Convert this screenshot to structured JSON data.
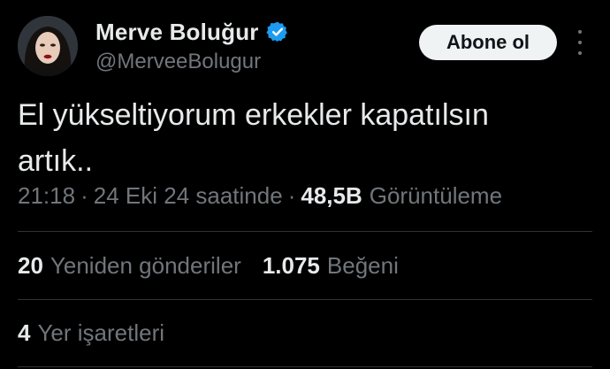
{
  "author": {
    "display_name": "Merve Boluğur",
    "handle": "@MerveeBolugur",
    "verified_icon": "verified-badge-icon"
  },
  "follow_button_label": "Abone ol",
  "more_icon": "more-options-icon",
  "tweet": {
    "text": "El yükseltiyorum erkekler kapatılsın\nartık.."
  },
  "meta": {
    "time": "21:18",
    "separator": "·",
    "date": "24 Eki 24 saatinde",
    "views_count": "48,5B",
    "views_label": "Görüntüleme"
  },
  "stats": {
    "reposts_count": "20",
    "reposts_label": "Yeniden gönderiler",
    "likes_count": "1.075",
    "likes_label": "Beğeni",
    "bookmarks_count": "4",
    "bookmarks_label": "Yer işaretleri"
  },
  "colors": {
    "background": "#000000",
    "primary_text": "#e7e9ea",
    "secondary_text": "#71767b",
    "divider": "#2f3336",
    "verified_blue": "#1d9bf0",
    "button_bg": "#eff3f4"
  }
}
